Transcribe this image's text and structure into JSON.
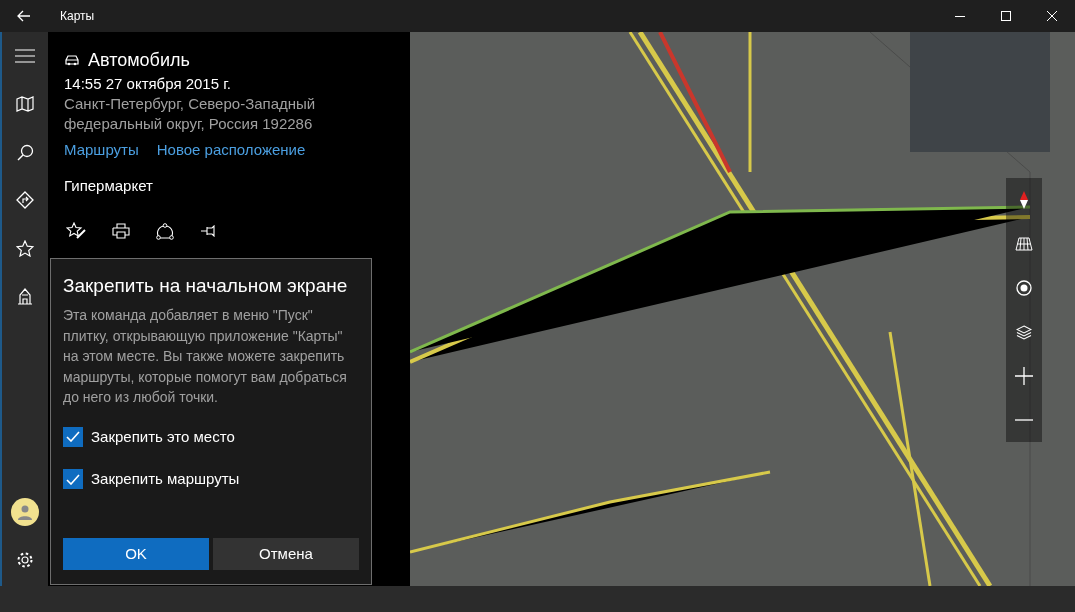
{
  "window": {
    "title": "Карты"
  },
  "place": {
    "title": "Автомобиль",
    "datetime": "14:55 27 октября 2015 г.",
    "address": "Санкт-Петербург, Северо-Западный федеральный округ, Россия 192286",
    "links": [
      "Маршруты",
      "Новое расположение"
    ],
    "category": "Гипермаркет"
  },
  "pin_flyout": {
    "title": "Закрепить на начальном экране",
    "body": "Эта команда добавляет в меню \"Пуск\" плитку, открывающую приложение \"Карты\" на этом месте. Вы также можете закрепить маршруты, которые помогут вам добраться до него из любой точки.",
    "options": [
      {
        "label": "Закрепить это место",
        "checked": true
      },
      {
        "label": "Закрепить маршруты",
        "checked": true
      }
    ],
    "buttons": [
      {
        "label": "OK",
        "kind": "primary"
      },
      {
        "label": "Отмена",
        "kind": "secondary"
      }
    ]
  }
}
